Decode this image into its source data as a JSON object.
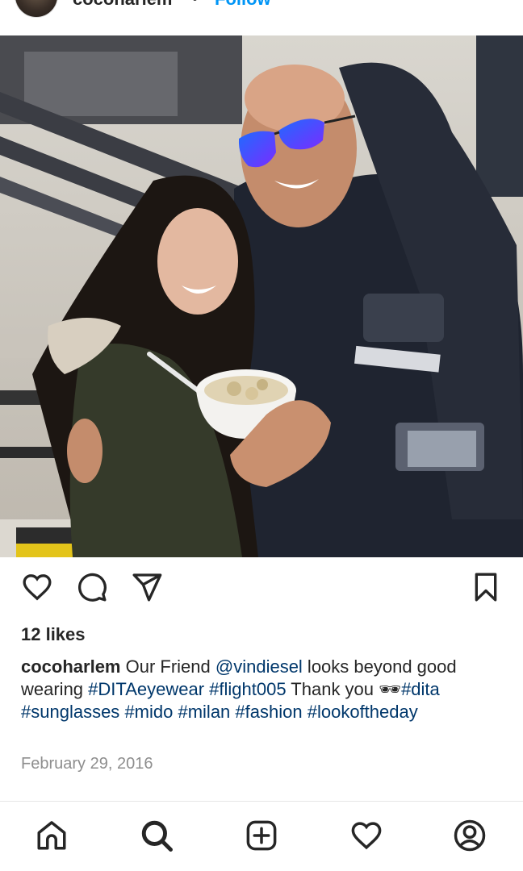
{
  "header": {
    "username": "cocoharlem",
    "separator": "•",
    "follow_label": "Follow"
  },
  "post": {
    "likes_text": "12 likes",
    "caption": {
      "username": "cocoharlem",
      "segments": [
        {
          "type": "text",
          "value": " Our Friend "
        },
        {
          "type": "mention",
          "value": "@vindiesel"
        },
        {
          "type": "text",
          "value": " looks beyond good wearing "
        },
        {
          "type": "tag",
          "value": "#DITAeyewear"
        },
        {
          "type": "text",
          "value": " "
        },
        {
          "type": "tag",
          "value": "#flight005"
        },
        {
          "type": "text",
          "value": " Thank you 🕶"
        },
        {
          "type": "tag",
          "value": "#dita"
        },
        {
          "type": "text",
          "value": " "
        },
        {
          "type": "tag",
          "value": "#sunglasses"
        },
        {
          "type": "text",
          "value": " "
        },
        {
          "type": "tag",
          "value": "#mido"
        },
        {
          "type": "text",
          "value": " "
        },
        {
          "type": "tag",
          "value": "#milan"
        },
        {
          "type": "text",
          "value": " "
        },
        {
          "type": "tag",
          "value": "#fashion"
        },
        {
          "type": "text",
          "value": " "
        },
        {
          "type": "tag",
          "value": "#lookoftheday"
        }
      ]
    },
    "date": "February 29, 2016"
  },
  "actions": {
    "like_icon": "heart-icon",
    "comment_icon": "comment-icon",
    "share_icon": "send-icon",
    "save_icon": "bookmark-icon"
  },
  "nav": {
    "items": [
      {
        "icon": "home-icon"
      },
      {
        "icon": "search-icon"
      },
      {
        "icon": "create-icon"
      },
      {
        "icon": "activity-icon"
      },
      {
        "icon": "profile-icon"
      }
    ]
  },
  "colors": {
    "link": "#00376b",
    "follow": "#0095f6",
    "muted": "#8e8e8e",
    "text": "#262626"
  }
}
